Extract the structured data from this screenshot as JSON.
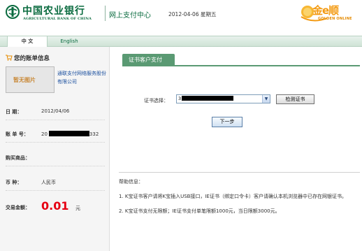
{
  "header": {
    "bank_name_cn": "中国农业银行",
    "bank_name_en": "AGRICULTURAL BANK OF CHINA",
    "title": "网上支付中心",
    "date": "2012-04-06 星期五",
    "golden_logo_cn": "金e顺",
    "golden_logo_en": "GOLDEN ONLINE"
  },
  "tabs": [
    {
      "label": "中 文",
      "active": true
    },
    {
      "label": "English",
      "active": false
    }
  ],
  "bill": {
    "title": "您的账单信息",
    "image_placeholder": "暂无图片",
    "merchant_name": "通联支付网络服务股份有限公司",
    "rows": [
      {
        "label": "日 期：",
        "value": "2012/04/06"
      },
      {
        "label": "账 单 号：",
        "value_prefix": "20",
        "value_suffix": "332"
      },
      {
        "label": "购买商品：",
        "value": ""
      },
      {
        "label": "币 种：",
        "value": "人民币"
      },
      {
        "label": "交易金额：",
        "value": "0.01",
        "unit": "元"
      }
    ]
  },
  "payment": {
    "panel_title": "证书客户支付",
    "cert_label": "证书选择：",
    "cert_value_prefix": "3",
    "check_cert_button": "检测证书",
    "next_button": "下一步"
  },
  "help": {
    "title": "帮助信息：",
    "items": [
      "1. K宝证书客户请将K宝插入USB接口，IE证书（绑定口令卡）客户请确认本机浏览器中已存在网银证书。",
      "2. K宝证书支付无限额；IE证书支付单笔限额1000元，当日限额3000元。"
    ]
  },
  "colors": {
    "brand_green": "#0a6b3f",
    "panel_green": "#5a9a73",
    "amount_red": "#e60012",
    "golden_orange": "#f39a12"
  }
}
